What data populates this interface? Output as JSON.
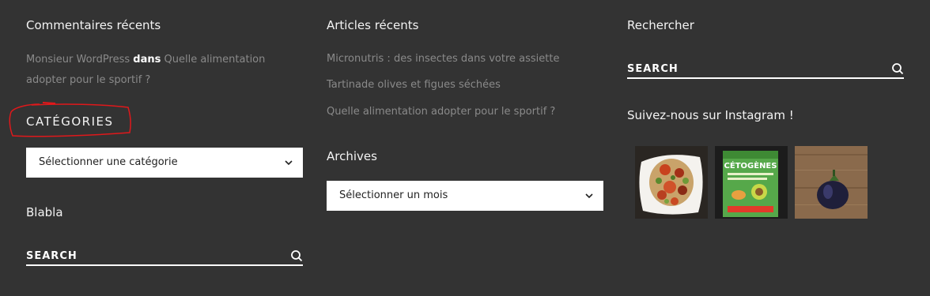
{
  "recent_comments": {
    "title": "Commentaires récents",
    "author": "Monsieur WordPress",
    "connector": "dans",
    "post": "Quelle alimentation adopter pour le sportif ?"
  },
  "categories": {
    "title": "CATÉGORIES",
    "select_value": "Sélectionner une catégorie"
  },
  "blabla": {
    "title": "Blabla",
    "search_placeholder": "SEARCH"
  },
  "recent_posts": {
    "title": "Articles récents",
    "items": [
      "Micronutris : des insectes dans votre assiette",
      "Tartinade olives et figues séchées",
      "Quelle alimentation adopter pour le sportif ?"
    ]
  },
  "archives": {
    "title": "Archives",
    "select_value": "Sélectionner un mois"
  },
  "search_widget": {
    "title": "Rechercher",
    "placeholder": "SEARCH"
  },
  "instagram": {
    "title": "Suivez-nous sur Instagram !",
    "book_text": "CÉTOGÈNES"
  },
  "colors": {
    "background": "#333333",
    "muted_text": "#8a8a8a",
    "annotation": "#e0181b"
  }
}
